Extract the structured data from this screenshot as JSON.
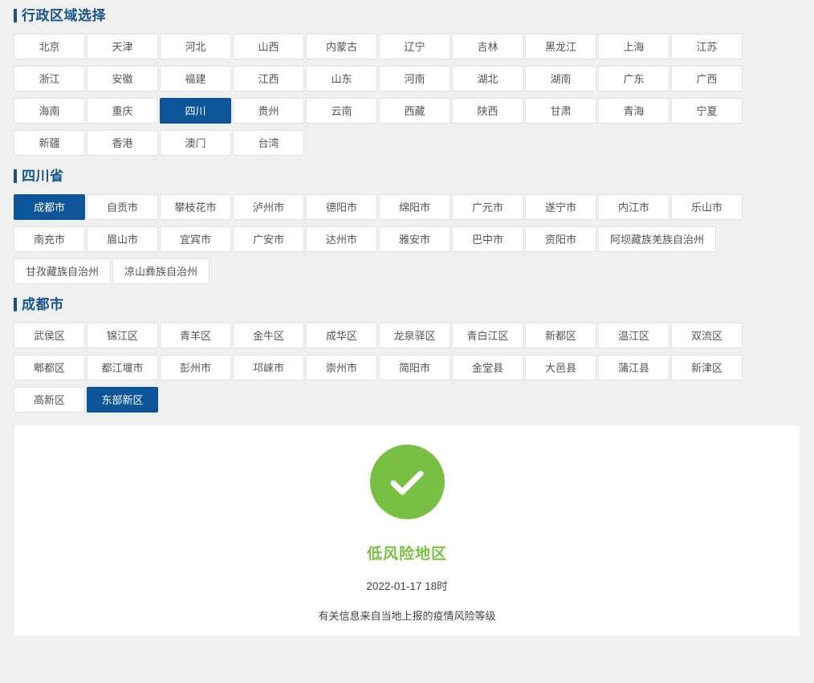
{
  "page": {
    "background": "#f0f0f0",
    "accent_blue": "#17548c",
    "selected_blue": "#0d5599",
    "risk_green": "#78c044"
  },
  "province_section": {
    "title": "行政区域选择",
    "items": [
      {
        "label": "北京",
        "selected": false
      },
      {
        "label": "天津",
        "selected": false
      },
      {
        "label": "河北",
        "selected": false
      },
      {
        "label": "山西",
        "selected": false
      },
      {
        "label": "内蒙古",
        "selected": false
      },
      {
        "label": "辽宁",
        "selected": false
      },
      {
        "label": "吉林",
        "selected": false
      },
      {
        "label": "黑龙江",
        "selected": false
      },
      {
        "label": "上海",
        "selected": false
      },
      {
        "label": "江苏",
        "selected": false
      },
      {
        "label": "浙江",
        "selected": false
      },
      {
        "label": "安徽",
        "selected": false
      },
      {
        "label": "福建",
        "selected": false
      },
      {
        "label": "江西",
        "selected": false
      },
      {
        "label": "山东",
        "selected": false
      },
      {
        "label": "河南",
        "selected": false
      },
      {
        "label": "湖北",
        "selected": false
      },
      {
        "label": "湖南",
        "selected": false
      },
      {
        "label": "广东",
        "selected": false
      },
      {
        "label": "广西",
        "selected": false
      },
      {
        "label": "海南",
        "selected": false
      },
      {
        "label": "重庆",
        "selected": false
      },
      {
        "label": "四川",
        "selected": true
      },
      {
        "label": "贵州",
        "selected": false
      },
      {
        "label": "云南",
        "selected": false
      },
      {
        "label": "西藏",
        "selected": false
      },
      {
        "label": "陕西",
        "selected": false
      },
      {
        "label": "甘肃",
        "selected": false
      },
      {
        "label": "青海",
        "selected": false
      },
      {
        "label": "宁夏",
        "selected": false
      },
      {
        "label": "新疆",
        "selected": false
      },
      {
        "label": "香港",
        "selected": false
      },
      {
        "label": "澳门",
        "selected": false
      },
      {
        "label": "台湾",
        "selected": false
      }
    ]
  },
  "city_section": {
    "title": "四川省",
    "items": [
      {
        "label": "成都市",
        "selected": true,
        "wide": false
      },
      {
        "label": "自贡市",
        "selected": false,
        "wide": false
      },
      {
        "label": "攀枝花市",
        "selected": false,
        "wide": false
      },
      {
        "label": "泸州市",
        "selected": false,
        "wide": false
      },
      {
        "label": "德阳市",
        "selected": false,
        "wide": false
      },
      {
        "label": "绵阳市",
        "selected": false,
        "wide": false
      },
      {
        "label": "广元市",
        "selected": false,
        "wide": false
      },
      {
        "label": "遂宁市",
        "selected": false,
        "wide": false
      },
      {
        "label": "内江市",
        "selected": false,
        "wide": false
      },
      {
        "label": "乐山市",
        "selected": false,
        "wide": false
      },
      {
        "label": "南充市",
        "selected": false,
        "wide": false
      },
      {
        "label": "眉山市",
        "selected": false,
        "wide": false
      },
      {
        "label": "宜宾市",
        "selected": false,
        "wide": false
      },
      {
        "label": "广安市",
        "selected": false,
        "wide": false
      },
      {
        "label": "达州市",
        "selected": false,
        "wide": false
      },
      {
        "label": "雅安市",
        "selected": false,
        "wide": false
      },
      {
        "label": "巴中市",
        "selected": false,
        "wide": false
      },
      {
        "label": "资阳市",
        "selected": false,
        "wide": false
      },
      {
        "label": "阿坝藏族羌族自治州",
        "selected": false,
        "wide": true
      },
      {
        "label": "甘孜藏族自治州",
        "selected": false,
        "wide": true
      },
      {
        "label": "凉山彝族自治州",
        "selected": false,
        "wide": true
      }
    ]
  },
  "district_section": {
    "title": "成都市",
    "items": [
      {
        "label": "武侯区",
        "selected": false
      },
      {
        "label": "锦江区",
        "selected": false
      },
      {
        "label": "青羊区",
        "selected": false
      },
      {
        "label": "金牛区",
        "selected": false
      },
      {
        "label": "成华区",
        "selected": false
      },
      {
        "label": "龙泉驿区",
        "selected": false
      },
      {
        "label": "青白江区",
        "selected": false
      },
      {
        "label": "新都区",
        "selected": false
      },
      {
        "label": "温江区",
        "selected": false
      },
      {
        "label": "双流区",
        "selected": false
      },
      {
        "label": "郫都区",
        "selected": false
      },
      {
        "label": "都江堰市",
        "selected": false
      },
      {
        "label": "彭州市",
        "selected": false
      },
      {
        "label": "邛崃市",
        "selected": false
      },
      {
        "label": "崇州市",
        "selected": false
      },
      {
        "label": "简阳市",
        "selected": false
      },
      {
        "label": "金堂县",
        "selected": false
      },
      {
        "label": "大邑县",
        "selected": false
      },
      {
        "label": "蒲江县",
        "selected": false
      },
      {
        "label": "新津区",
        "selected": false
      },
      {
        "label": "高新区",
        "selected": false
      },
      {
        "label": "东部新区",
        "selected": true
      }
    ]
  },
  "result": {
    "icon": "check-circle-icon",
    "risk_level": "低风险地区",
    "timestamp": "2022-01-17 18时",
    "note": "有关信息来自当地上报的疫情风险等级"
  }
}
